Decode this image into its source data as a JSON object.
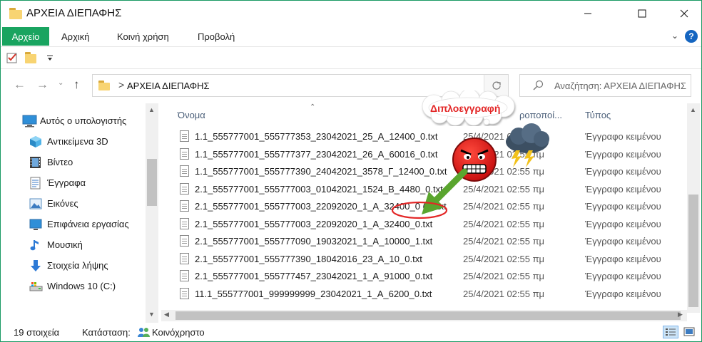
{
  "window": {
    "title": "ΑΡΧΕΙΑ ΔΙΕΠΑΦΗΣ"
  },
  "ribbon": {
    "tabs": [
      {
        "label": "Αρχείο"
      },
      {
        "label": "Αρχική"
      },
      {
        "label": "Κοινή χρήση"
      },
      {
        "label": "Προβολή"
      }
    ],
    "help_label": "?"
  },
  "address": {
    "path": "ΑΡΧΕΙΑ ΔΙΕΠΑΦΗΣ",
    "separator": ">"
  },
  "search": {
    "placeholder": "Αναζήτηση: ΑΡΧΕΙΑ ΔΙΕΠΑΦΗΣ"
  },
  "nav_pane": {
    "items": [
      {
        "label": "Αυτός ο υπολογιστής",
        "icon": "computer-icon"
      },
      {
        "label": "Αντικείμενα 3D",
        "icon": "cube-3d-icon"
      },
      {
        "label": "Βίντεο",
        "icon": "video-icon"
      },
      {
        "label": "Έγγραφα",
        "icon": "documents-icon"
      },
      {
        "label": "Εικόνες",
        "icon": "pictures-icon"
      },
      {
        "label": "Επιφάνεια εργασίας",
        "icon": "desktop-icon"
      },
      {
        "label": "Μουσική",
        "icon": "music-icon"
      },
      {
        "label": "Στοιχεία λήψης",
        "icon": "downloads-icon"
      },
      {
        "label": "Windows 10 (C:)",
        "icon": "drive-icon"
      }
    ]
  },
  "columns": {
    "name": "Όνομα",
    "modified": "ροποποί...",
    "type": "Τύπος"
  },
  "files": [
    {
      "name": "1.1_555777001_555777353_23042021_25_Α_12400_0.txt",
      "date": "25/4/2021 02:55 πμ",
      "type": "Έγγραφο κειμένου"
    },
    {
      "name": "1.1_555777001_555777377_23042021_26_Α_60016_0.txt",
      "date": "25/4/2021 02:55 πμ",
      "type": "Έγγραφο κειμένου"
    },
    {
      "name": "1.1_555777001_555777390_24042021_3578_Γ_12400_0.txt",
      "date": "25/4/2021 02:55 πμ",
      "type": "Έγγραφο κειμένου"
    },
    {
      "name": "2.1_555777001_555777003_01042021_1524_Β_4480_0.txt",
      "date": "25/4/2021 02:55 πμ",
      "type": "Έγγραφο κειμένου"
    },
    {
      "name": "2.1_555777001_555777003_22092020_1_Α_32400_0 (1).txt",
      "date": "25/4/2021 02:55 πμ",
      "type": "Έγγραφο κειμένου"
    },
    {
      "name": "2.1_555777001_555777003_22092020_1_Α_32400_0.txt",
      "date": "25/4/2021 02:55 πμ",
      "type": "Έγγραφο κειμένου"
    },
    {
      "name": "2.1_555777001_555777090_19032021_1_Α_10000_1.txt",
      "date": "25/4/2021 02:55 πμ",
      "type": "Έγγραφο κειμένου"
    },
    {
      "name": "2.1_555777001_555777390_18042016_23_Α_10_0.txt",
      "date": "25/4/2021 02:55 πμ",
      "type": "Έγγραφο κειμένου"
    },
    {
      "name": "2.1_555777001_555777457_23042021_1_Α_91000_0.txt",
      "date": "25/4/2021 02:55 πμ",
      "type": "Έγγραφο κειμένου"
    },
    {
      "name": "11.1_555777001_999999999_23042021_1_Α_6200_0.txt",
      "date": "25/4/2021 02:55 πμ",
      "type": "Έγγραφο κειμένου"
    }
  ],
  "status": {
    "count": "19 στοιχεία",
    "state_label": "Κατάσταση:",
    "state_value": "Κοινόχρηστο"
  },
  "annotation": {
    "bubble_text": "Διπλοεγγραφή"
  },
  "colors": {
    "accent": "#19a460",
    "annotation_red": "#e32626",
    "arrow_green": "#5aa52e"
  }
}
